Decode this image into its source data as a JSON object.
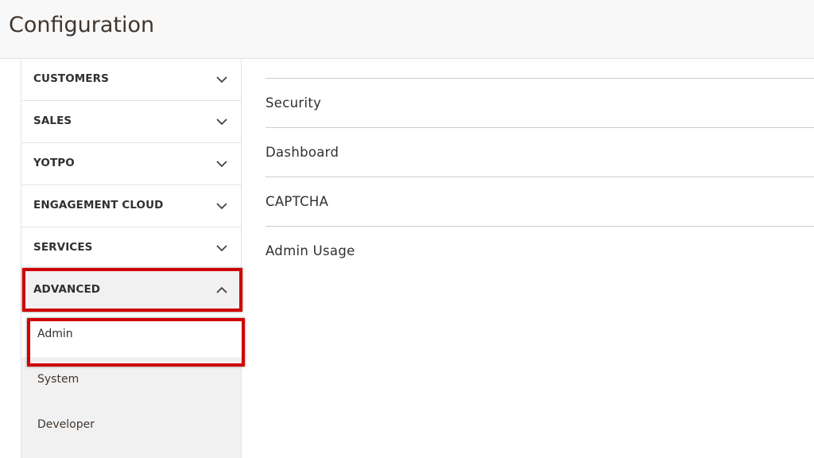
{
  "header": {
    "title": "Configuration"
  },
  "sidebar": {
    "sections": [
      {
        "label": "CUSTOMERS",
        "icon": "chevron-down-icon"
      },
      {
        "label": "SALES",
        "icon": "chevron-down-icon"
      },
      {
        "label": "YOTPO",
        "icon": "chevron-down-icon"
      },
      {
        "label": "ENGAGEMENT CLOUD",
        "icon": "chevron-down-icon"
      },
      {
        "label": "SERVICES",
        "icon": "chevron-down-icon"
      },
      {
        "label": "ADVANCED",
        "icon": "chevron-up-icon",
        "expanded": true
      }
    ],
    "advanced_items": [
      {
        "label": "Admin",
        "active": true
      },
      {
        "label": "System"
      },
      {
        "label": "Developer"
      }
    ]
  },
  "main": {
    "groups": [
      {
        "title": "Security"
      },
      {
        "title": "Dashboard"
      },
      {
        "title": "CAPTCHA"
      },
      {
        "title": "Admin Usage"
      }
    ]
  },
  "colors": {
    "highlight": "#d10000",
    "header_bg": "#f8f8f8",
    "active_section_bg": "#f1f1f1"
  }
}
